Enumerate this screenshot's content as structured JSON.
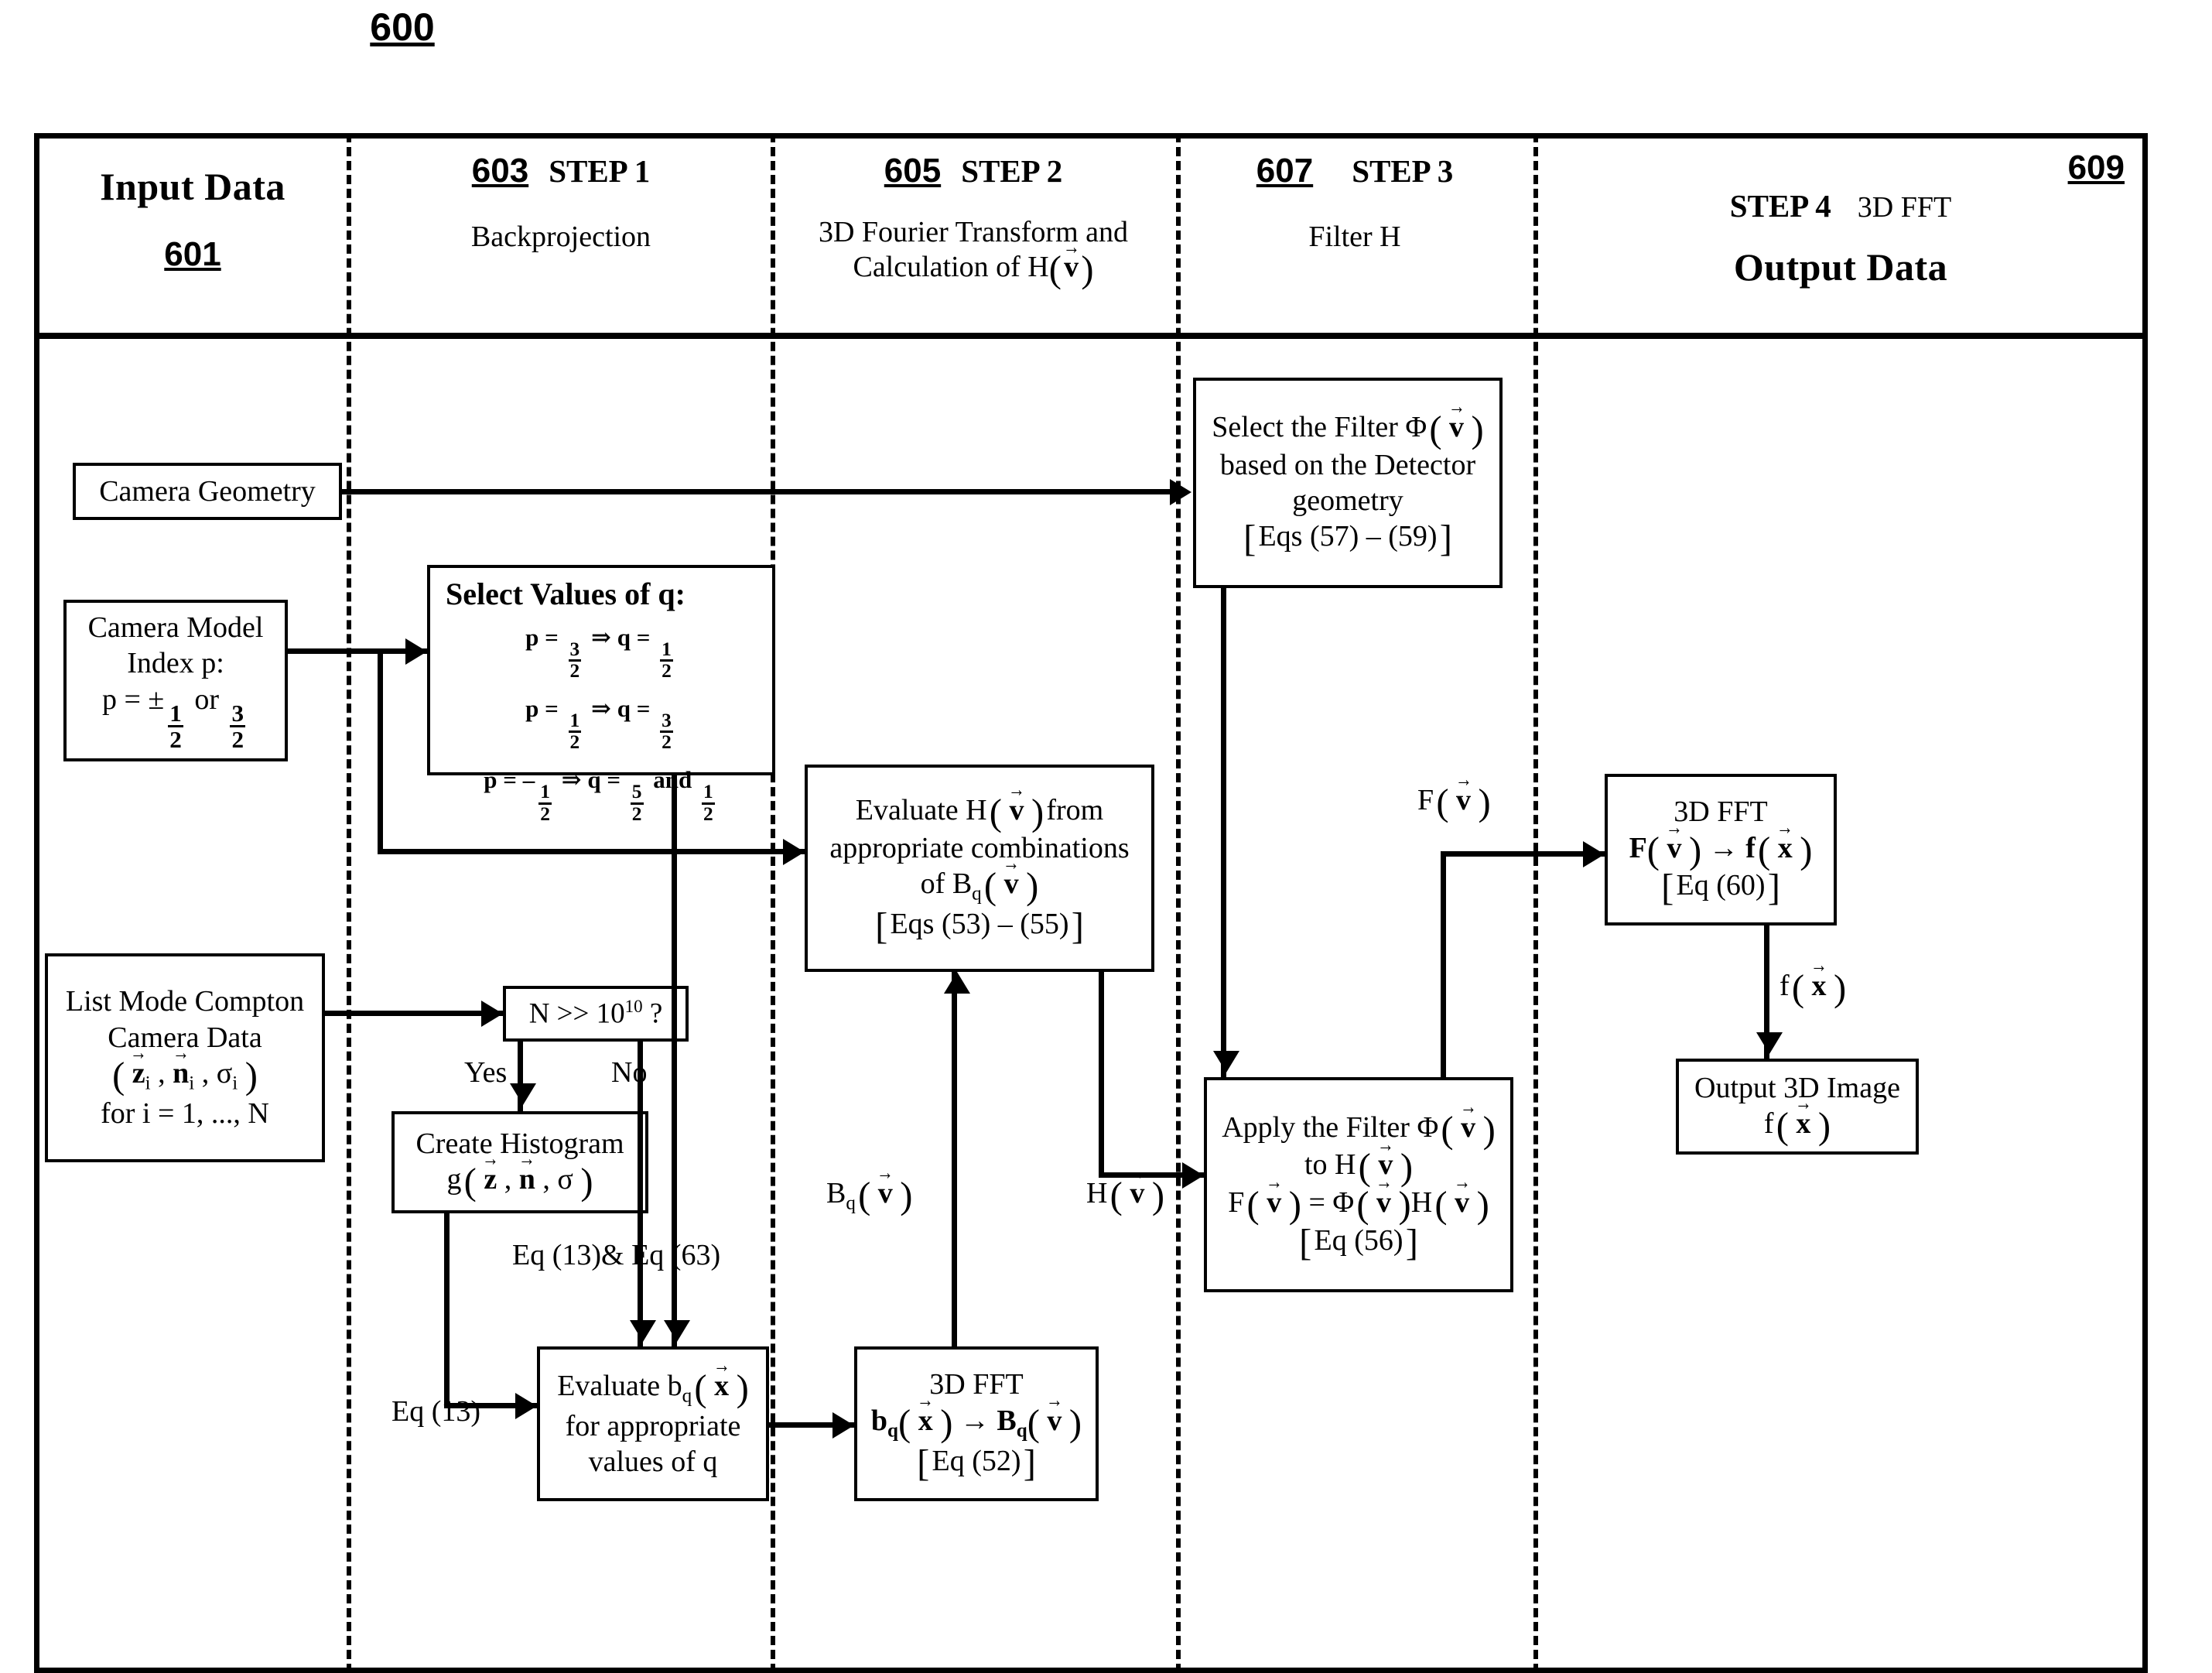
{
  "figure": {
    "number": "600"
  },
  "columns": [
    {
      "ref": "601",
      "title": "Input Data",
      "step": "",
      "subtitle": ""
    },
    {
      "ref": "603",
      "title": "",
      "step": "STEP 1",
      "subtitle": "Backprojection"
    },
    {
      "ref": "605",
      "title": "",
      "step": "STEP 2",
      "subtitle": "3D Fourier Transform and Calculation of H( v )"
    },
    {
      "ref": "607",
      "title": "",
      "step": "STEP 3",
      "subtitle": "Filter H"
    },
    {
      "ref": "609",
      "title": "Output Data",
      "step": "STEP 4",
      "subtitle": "3D FFT"
    }
  ],
  "nodes": {
    "camera_geometry": {
      "label": "Camera Geometry"
    },
    "camera_model": {
      "line1": "Camera Model",
      "line2": "Index p:",
      "line3_prefix": "p = ±",
      "line3_frac1": "1/2",
      "line3_mid": "or",
      "line3_frac2": "3/2"
    },
    "select_values_q": {
      "title": "Select Values of q:",
      "rows": [
        {
          "p_num": "3",
          "p_den": "2",
          "q_num": "1",
          "q_den": "2",
          "p_sign": "",
          "extra": ""
        },
        {
          "p_num": "1",
          "p_den": "2",
          "q_num": "3",
          "q_den": "2",
          "p_sign": "",
          "extra": ""
        },
        {
          "p_num": "1",
          "p_den": "2",
          "q_num": "5",
          "q_den": "2",
          "p_sign": "–",
          "extra": "and 1/2"
        }
      ]
    },
    "list_mode_data": {
      "line1": "List Mode Compton",
      "line2": "Camera Data",
      "line3": "( z⃗ i , n⃗ i , σ i )",
      "line4": "for  i = 1, ..., N"
    },
    "decision_n": {
      "label": "N >> 10^10 ?"
    },
    "create_histogram": {
      "line1": "Create Histogram",
      "line2": "g ( z⃗ , n⃗ , σ )"
    },
    "evaluate_bq": {
      "line1": "Evaluate b_q ( x⃗ )",
      "line2": "for appropriate",
      "line3": "values of q"
    },
    "fft_bq": {
      "line1": "3D FFT",
      "line2": "b_q ( x⃗ ) → B_q ( v⃗ )",
      "line3": "[ Eq (52) ]"
    },
    "evaluate_h": {
      "line1": "Evaluate H ( v⃗ ) from",
      "line2": "appropriate combinations",
      "line3": "of B_q ( v⃗ )",
      "line4": "[ Eqs (53) – (55) ]"
    },
    "select_filter": {
      "line1": "Select the Filter Φ ( v⃗ )",
      "line2": "based on the Detector",
      "line3": "geometry",
      "line4": "[ Eqs (57) – (59) ]"
    },
    "apply_filter": {
      "line1": "Apply the Filter Φ ( v⃗ )",
      "line2": "to H ( v⃗ )",
      "line3": "F ( v⃗ ) = Φ ( v⃗ ) H ( v⃗ )",
      "line4": "[ Eq (56) ]"
    },
    "fft_output": {
      "line1": "3D FFT",
      "line2": "F ( v⃗ ) → f ( x⃗ )",
      "line3": "[ Eq (60) ]"
    },
    "output_image": {
      "line1": "Output 3D Image",
      "line2": "f ( x⃗ )"
    }
  },
  "edge_labels": {
    "yes": "Yes",
    "no": "No",
    "eq13_and_eq63_line1": "Eq (13)&",
    "eq13_and_eq63_line2": "Eq (63)",
    "eq13": "Eq (13)",
    "bq_v": "B_q ( v⃗ )",
    "h_v": "H ( v⃗ )",
    "f_v": "F ( v⃗ )",
    "f_x": "f ( x⃗ )"
  },
  "colors": {
    "ink": "#000000",
    "paper": "#ffffff"
  }
}
